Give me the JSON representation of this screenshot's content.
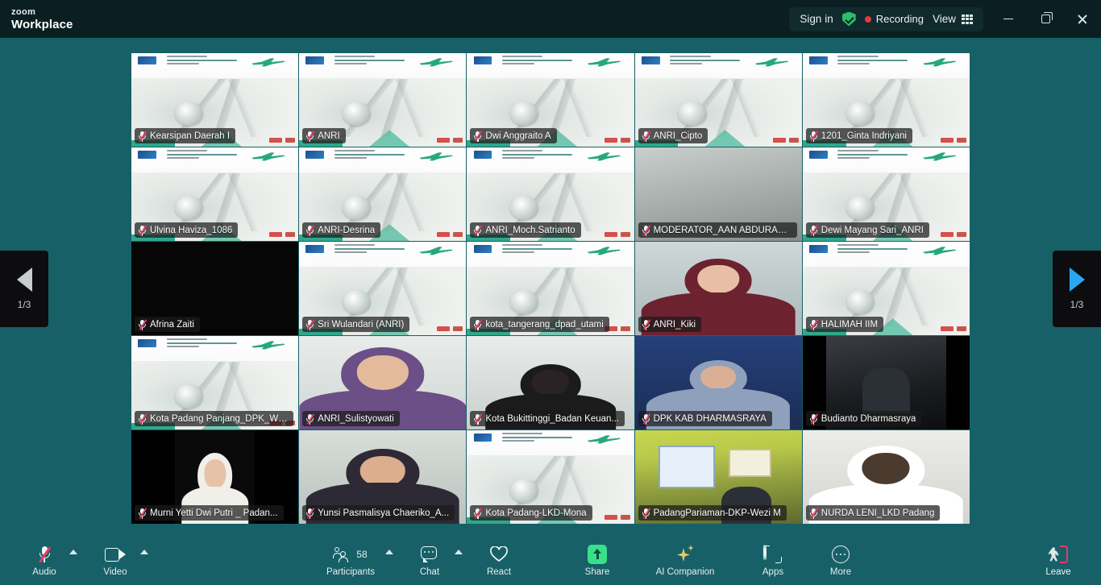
{
  "titlebar": {
    "brand_top": "zoom",
    "brand_bottom": "Workplace",
    "sign_in": "Sign in",
    "shield_icon": "security-shield-icon",
    "recording_label": "Recording",
    "view_label": "View",
    "view_icon": "grid-view-icon",
    "minimize_icon": "minimize-icon",
    "maximize_icon": "restore-icon",
    "close_icon": "close-icon"
  },
  "pager": {
    "prev_label": "1/3",
    "next_label": "1/3",
    "prev_icon": "chevron-left-icon",
    "next_icon": "chevron-right-icon"
  },
  "gallery": {
    "tiles": [
      {
        "name": "Kearsipan Daerah I",
        "muted": true,
        "kind": "slide"
      },
      {
        "name": "ANRI",
        "muted": true,
        "kind": "slide"
      },
      {
        "name": "Dwi Anggraito A",
        "muted": true,
        "kind": "slide"
      },
      {
        "name": "ANRI_Cipto",
        "muted": true,
        "kind": "slide"
      },
      {
        "name": "1201_Ginta Indriyani",
        "muted": true,
        "kind": "slide"
      },
      {
        "name": "Ulvina Haviza_1086",
        "muted": true,
        "kind": "slide"
      },
      {
        "name": "ANRI-Desrina",
        "muted": true,
        "kind": "slide"
      },
      {
        "name": "ANRI_Moch.Satrianto",
        "muted": true,
        "kind": "slide"
      },
      {
        "name": "MODERATOR_AAN ABDURAC...",
        "muted": true,
        "kind": "gray"
      },
      {
        "name": "Dewi Mayang Sari_ANRI",
        "muted": true,
        "kind": "slide"
      },
      {
        "name": "Afrina Zaiti",
        "muted": true,
        "kind": "dark"
      },
      {
        "name": "Sri Wulandari (ANRI)",
        "muted": true,
        "kind": "slide"
      },
      {
        "name": "kota_tangerang_dpad_utami",
        "muted": true,
        "kind": "slide"
      },
      {
        "name": "ANRI_Kiki",
        "muted": true,
        "kind": "person-hijab-maroon"
      },
      {
        "name": "HALIMAH IIM",
        "muted": true,
        "kind": "slide"
      },
      {
        "name": "Kota Padang Panjang_DPK_Wi...",
        "muted": true,
        "kind": "slide"
      },
      {
        "name": "ANRI_Sulistyowati",
        "muted": true,
        "kind": "person-hijab-purple",
        "active": true
      },
      {
        "name": "Kota Bukittinggi_Badan Keuan...",
        "muted": true,
        "kind": "person-dark-silhouette"
      },
      {
        "name": "DPK KAB DHARMASRAYA",
        "muted": true,
        "kind": "person-group-blue"
      },
      {
        "name": "Budianto Dharmasraya",
        "muted": true,
        "kind": "dark-room"
      },
      {
        "name": "Murni Yetti Dwi Putri _ Padan...",
        "muted": true,
        "kind": "person-white-hijab"
      },
      {
        "name": "Yunsi Pasmalisya Chaeriko_A...",
        "muted": true,
        "kind": "person-hijab-dark"
      },
      {
        "name": "Kota Padang-LKD-Mona",
        "muted": true,
        "kind": "slide"
      },
      {
        "name": "PadangPariaman-DKP-Wezi M",
        "muted": true,
        "kind": "room-yellow"
      },
      {
        "name": "NURDA LENI_LKD Padang",
        "muted": true,
        "kind": "person-face-mask"
      }
    ]
  },
  "toolbar": {
    "audio_label": "Audio",
    "audio_icon": "microphone-muted-icon",
    "audio_caret_icon": "chevron-up-icon",
    "video_label": "Video",
    "video_icon": "camera-icon",
    "video_caret_icon": "chevron-up-icon",
    "participants_label": "Participants",
    "participants_icon": "people-icon",
    "participants_count": "58",
    "participants_caret_icon": "chevron-up-icon",
    "chat_label": "Chat",
    "chat_icon": "chat-bubble-icon",
    "chat_caret_icon": "chevron-up-icon",
    "react_label": "React",
    "react_icon": "heart-icon",
    "share_label": "Share",
    "share_icon": "share-screen-icon",
    "ai_label": "AI Companion",
    "ai_icon": "sparkle-icon",
    "apps_label": "Apps",
    "apps_icon": "apps-icon",
    "more_label": "More",
    "more_icon": "ellipsis-icon",
    "leave_label": "Leave",
    "leave_icon": "leave-door-icon"
  },
  "colors": {
    "stage_bg": "#176068",
    "titlebar_bg": "#0b1f22",
    "accent_green": "#39d98a",
    "recording_red": "#e8373d",
    "share_green": "#39e08c",
    "leave_pink": "#e8376b",
    "next_arrow_blue": "#2aa7f0"
  }
}
